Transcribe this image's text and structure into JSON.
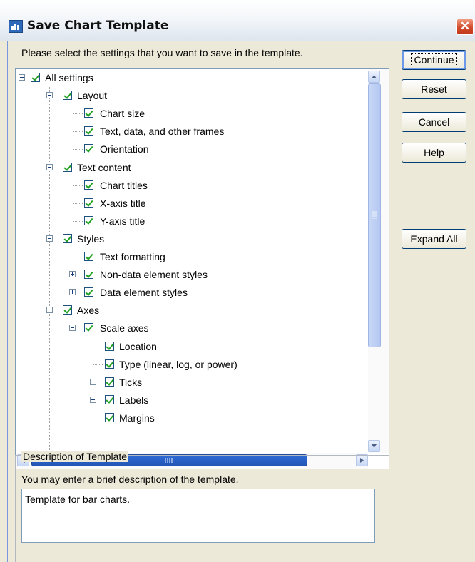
{
  "window": {
    "title": "Save Chart Template",
    "close_glyph": "✕"
  },
  "instructions": "Please select the settings that you want to save in the template.",
  "buttons": {
    "continue": "Continue",
    "reset": "Reset",
    "cancel": "Cancel",
    "help": "Help",
    "expand_all": "Expand All"
  },
  "tree": {
    "all_settings": "All settings",
    "layout": "Layout",
    "chart_size": "Chart size",
    "text_frames": "Text, data, and other frames",
    "orientation": "Orientation",
    "text_content": "Text content",
    "chart_titles": "Chart titles",
    "x_axis_title": "X-axis title",
    "y_axis_title": "Y-axis title",
    "styles": "Styles",
    "text_formatting": "Text formatting",
    "non_data_styles": "Non-data element styles",
    "data_styles": "Data element styles",
    "axes": "Axes",
    "scale_axes": "Scale axes",
    "location": "Location",
    "type": "Type (linear, log, or power)",
    "ticks": "Ticks",
    "labels": "Labels",
    "margins": "Margins"
  },
  "description": {
    "group_label": "Description of Template",
    "help_text": "You may enter a brief description of the template.",
    "value": "Template for bar charts."
  },
  "icons": {
    "checkbox": "checkbox-checked-icon",
    "expand": "collapse-icon",
    "scroll_up": "scroll-up-arrow-icon",
    "scroll_down": "scroll-down-arrow-icon",
    "scroll_left": "scroll-left-arrow-icon",
    "scroll_right": "scroll-right-arrow-icon",
    "app": "chart-app-icon"
  }
}
